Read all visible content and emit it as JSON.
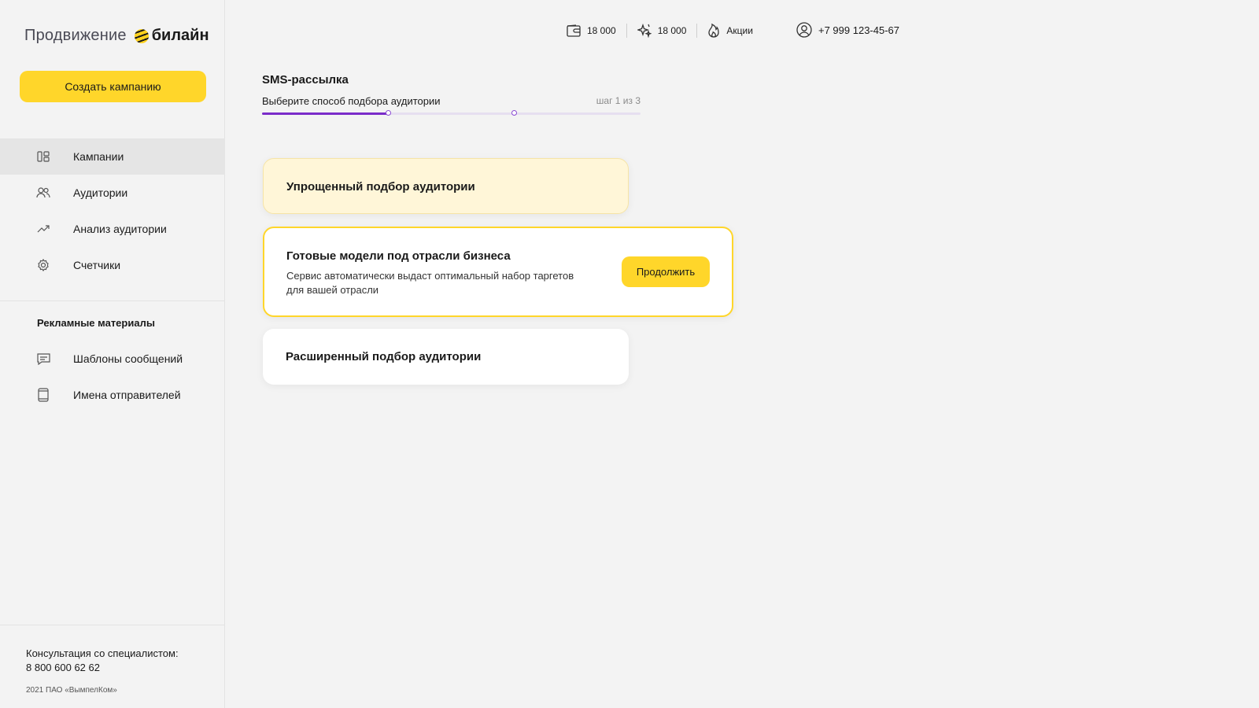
{
  "logo": {
    "product": "Продвижение",
    "brand": "билайн"
  },
  "sidebar": {
    "create_button": "Создать кампанию",
    "items": [
      {
        "label": "Кампании",
        "icon": "dashboard-icon",
        "active": true
      },
      {
        "label": "Аудитории",
        "icon": "users-icon"
      },
      {
        "label": "Анализ аудитории",
        "icon": "trend-icon"
      },
      {
        "label": "Счетчики",
        "icon": "gear-icon"
      }
    ],
    "section_title": "Рекламные материалы",
    "materials": [
      {
        "label": "Шаблоны сообщений",
        "icon": "message-icon"
      },
      {
        "label": "Имена отправителей",
        "icon": "phone-device-icon"
      }
    ],
    "consult_label": "Консультация со специалистом:",
    "consult_phone": "8 800 600 62 62",
    "copyright": "2021 ПАО «ВымпелКом»"
  },
  "header": {
    "balance": "18 000",
    "bonus": "18 000",
    "promo": "Акции",
    "phone": "+7 999 123-45-67"
  },
  "wizard": {
    "title": "SMS-рассылка",
    "subtitle": "Выберите способ подбора аудитории",
    "step": "шаг 1 из 3",
    "progress": 0.333
  },
  "options": [
    {
      "title": "Упрощенный подбор аудитории"
    },
    {
      "title": "Готовые модели под отрасли бизнеса",
      "description": "Сервис автоматически выдаст оптимальный набор таргетов для вашей отрасли",
      "button": "Продолжить"
    },
    {
      "title": "Расширенный подбор аудитории"
    }
  ],
  "colors": {
    "accent": "#ffd62a",
    "progress": "#7a2cc9"
  }
}
